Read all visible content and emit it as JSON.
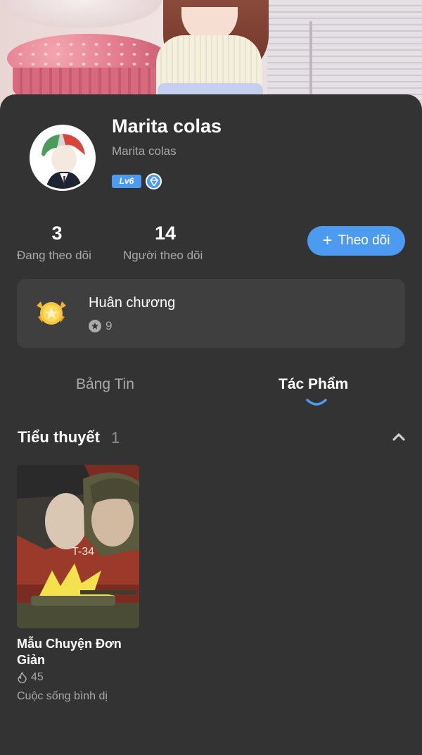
{
  "profile": {
    "display_name": "Marita colas",
    "username": "Marita colas",
    "level_badge": "Lv6",
    "verified_icon": "diamond-badge-icon"
  },
  "stats": {
    "following_count": "3",
    "following_label": "Đang theo dõi",
    "followers_count": "14",
    "followers_label": "Người theo dõi"
  },
  "follow_button": {
    "icon": "plus-icon",
    "label": "Theo dõi"
  },
  "medals": {
    "icon": "medal-icon",
    "title": "Huân chương",
    "count_icon": "star-circle-icon",
    "count": "9"
  },
  "tabs": [
    {
      "label": "Bảng Tin",
      "active": false
    },
    {
      "label": "Tác Phẩm",
      "active": true
    }
  ],
  "section": {
    "title": "Tiểu thuyết",
    "count": "1",
    "toggle_icon": "chevron-up-icon"
  },
  "works": [
    {
      "title": "Mẫu Chuyện Đơn Giản",
      "stat_icon": "flame-icon",
      "views": "45",
      "genre": "Cuộc sống bình dị"
    }
  ],
  "colors": {
    "accent": "#4d9bf0",
    "background": "#333333",
    "card": "#3f3f3f",
    "muted_text": "#a9a9a9"
  }
}
